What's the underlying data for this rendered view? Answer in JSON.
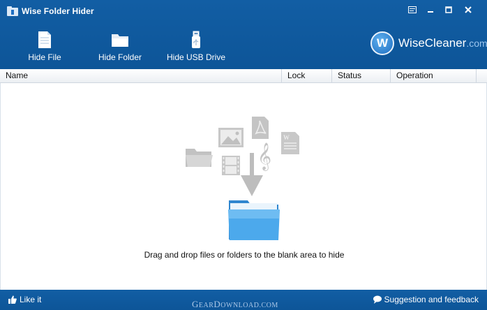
{
  "window": {
    "title": "Wise Folder Hider",
    "controls": [
      "menu-icon",
      "minimize-icon",
      "maximize-icon",
      "close-icon"
    ]
  },
  "toolbar": {
    "items": [
      {
        "label": "Hide File",
        "icon": "file-icon"
      },
      {
        "label": "Hide Folder",
        "icon": "folder-icon"
      },
      {
        "label": "Hide USB Drive",
        "icon": "usb-drive-icon"
      }
    ]
  },
  "brand": {
    "name": "WiseCleaner",
    "suffix": ".com",
    "logo_letter": "W"
  },
  "table": {
    "columns": [
      "Name",
      "Lock",
      "Status",
      "Operation"
    ]
  },
  "dropzone": {
    "hint": "Drag and drop files or folders to the blank area to hide",
    "icons": [
      "folder-icon",
      "image-icon",
      "pdf-icon",
      "music-icon",
      "document-icon",
      "video-icon",
      "arrow-down-icon",
      "target-folder-icon"
    ]
  },
  "footer": {
    "like_label": "Like it",
    "feedback_label": "Suggestion and feedback",
    "watermark": {
      "G": "G",
      "ear": "EAR",
      "D": "D",
      "ownload": "OWNLOAD",
      "tld": ".COM"
    }
  },
  "colors": {
    "header_blue": "#125ea4",
    "accent_folder": "#3a9ee6",
    "icon_gray": "#c8c8c8"
  }
}
